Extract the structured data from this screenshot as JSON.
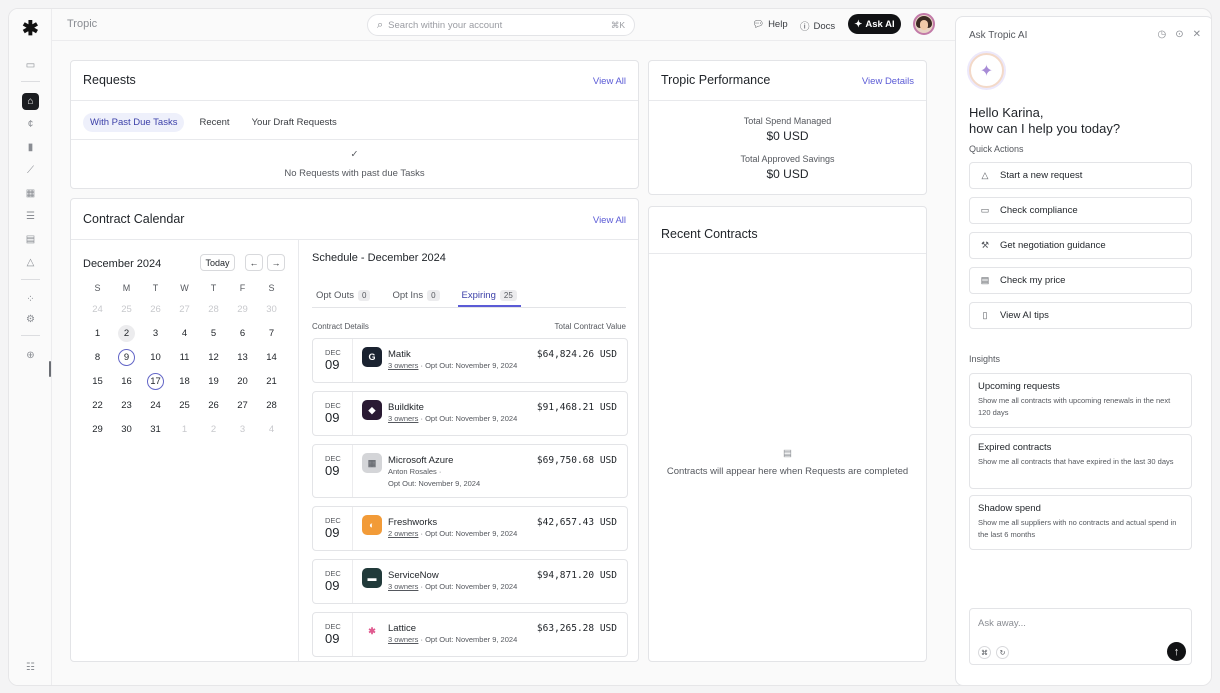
{
  "app": {
    "brand": "Tropic",
    "search_placeholder": "Search within your account",
    "search_shortcut": "⌘K",
    "help_label": "Help",
    "docs_label": "Docs",
    "ask_ai_label": "Ask AI"
  },
  "requests": {
    "title": "Requests",
    "view_all": "View All",
    "tabs": [
      "With Past Due Tasks",
      "Recent",
      "Your Draft Requests"
    ],
    "empty_text": "No Requests with past due Tasks"
  },
  "performance": {
    "title": "Tropic Performance",
    "view_details": "View Details",
    "total_spend_label": "Total Spend Managed",
    "total_spend_value": "$0 USD",
    "savings_label": "Total Approved Savings",
    "savings_value": "$0 USD"
  },
  "calendar": {
    "title": "Contract Calendar",
    "view_all": "View All",
    "month": "December 2024",
    "today_label": "Today",
    "weekdays": [
      "S",
      "M",
      "T",
      "W",
      "T",
      "F",
      "S"
    ],
    "weeks": [
      [
        "24",
        "25",
        "26",
        "27",
        "28",
        "29",
        "30"
      ],
      [
        "1",
        "2",
        "3",
        "4",
        "5",
        "6",
        "7"
      ],
      [
        "8",
        "9",
        "10",
        "11",
        "12",
        "13",
        "14"
      ],
      [
        "15",
        "16",
        "17",
        "18",
        "19",
        "20",
        "21"
      ],
      [
        "22",
        "23",
        "24",
        "25",
        "26",
        "27",
        "28"
      ],
      [
        "29",
        "30",
        "31",
        "1",
        "2",
        "3",
        "4"
      ]
    ]
  },
  "schedule": {
    "title": "Schedule - December 2024",
    "tabs": [
      {
        "label": "Opt Outs",
        "count": "0"
      },
      {
        "label": "Opt Ins",
        "count": "0"
      },
      {
        "label": "Expiring",
        "count": "25"
      }
    ],
    "col_details": "Contract Details",
    "col_value": "Total Contract Value",
    "contracts": [
      {
        "month": "DEC",
        "day": "09",
        "name": "Matik",
        "owners": "3 owners",
        "sub": " · Opt Out: November 9, 2024",
        "value": "$64,824.26 USD",
        "logo_color": "#1a2230",
        "logo_text": "G"
      },
      {
        "month": "DEC",
        "day": "09",
        "name": "Buildkite",
        "owners": "3 owners",
        "sub": " · Opt Out: November 9, 2024",
        "value": "$91,468.21 USD",
        "logo_color": "#2a1a33",
        "logo_text": "◆"
      },
      {
        "month": "DEC",
        "day": "09",
        "name": "Microsoft Azure",
        "owners": "Anton Rosales ·",
        "sub": "Opt Out: November 9, 2024",
        "value": "$69,750.68 USD",
        "logo_color": "#d4d5d8",
        "logo_text": "▦"
      },
      {
        "month": "DEC",
        "day": "09",
        "name": "Freshworks",
        "owners": "2 owners",
        "sub": " · Opt Out: November 9, 2024",
        "value": "$42,657.43 USD",
        "logo_color": "#f29b38",
        "logo_text": "◐"
      },
      {
        "month": "DEC",
        "day": "09",
        "name": "ServiceNow",
        "owners": "3 owners",
        "sub": " · Opt Out: November 9, 2024",
        "value": "$94,871.20 USD",
        "logo_color": "#213a3a",
        "logo_text": "▬"
      },
      {
        "month": "DEC",
        "day": "09",
        "name": "Lattice",
        "owners": "3 owners",
        "sub": " · Opt Out: November 9, 2024",
        "value": "$63,265.28 USD",
        "logo_color": "#ffffff",
        "logo_text": "✱"
      }
    ]
  },
  "recent_contracts": {
    "title": "Recent Contracts",
    "empty_text": "Contracts will appear here when Requests are completed"
  },
  "ai": {
    "title": "Ask Tropic AI",
    "greeting_line1": "Hello Karina,",
    "greeting_line2": "how can I help you today?",
    "quick_actions_label": "Quick Actions",
    "quick_actions": [
      "Start a new request",
      "Check compliance",
      "Get negotiation guidance",
      "Check my price",
      "View AI tips"
    ],
    "insights_label": "Insights",
    "insights": [
      {
        "title": "Upcoming requests",
        "body": "Show me all contracts with upcoming renewals in the next 120 days"
      },
      {
        "title": "Expired contracts",
        "body": "Show me all contracts that have expired in the last 30 days"
      },
      {
        "title": "Shadow spend",
        "body": "Show me all suppliers with no contracts and actual spend in the last 6 months"
      }
    ],
    "input_placeholder": "Ask away..."
  }
}
